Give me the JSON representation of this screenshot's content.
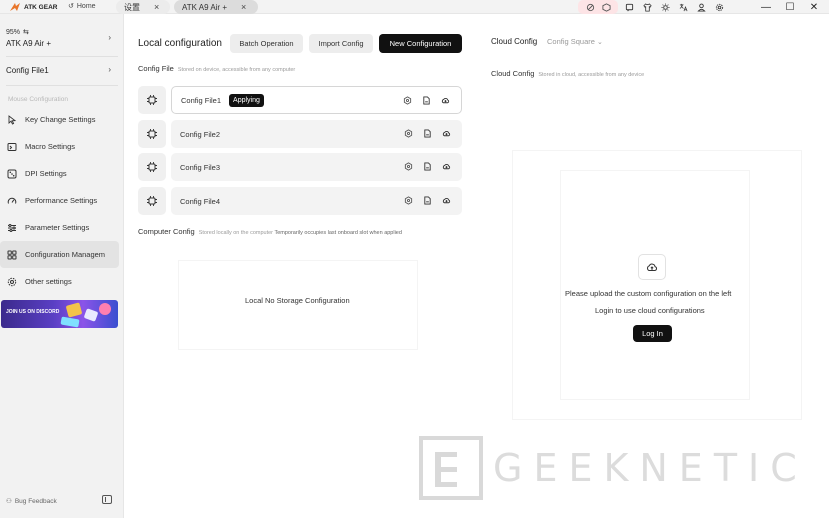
{
  "titlebar": {
    "app_name": "ATK GEAR",
    "home_label": "Home",
    "tabs": [
      {
        "label": "设置",
        "close": "×"
      },
      {
        "label": "ATK A9 Air +",
        "close": "×"
      }
    ],
    "icons": [
      "cancel-icon",
      "box-icon",
      "chat-icon",
      "shirt-icon",
      "sun-icon",
      "translate-icon",
      "user-icon",
      "gear-icon"
    ],
    "window_controls": [
      "minimize",
      "maximize",
      "close"
    ]
  },
  "sidebar": {
    "battery": "95%",
    "device_name": "ATK A9 Air +",
    "config_selector": "Config File1",
    "section_label": "Mouse Configuration",
    "items": [
      {
        "label": "Key Change Settings",
        "icon": "cursor-icon",
        "active": false
      },
      {
        "label": "Macro Settings",
        "icon": "macro-icon",
        "active": false
      },
      {
        "label": "DPI Settings",
        "icon": "dice-icon",
        "active": false
      },
      {
        "label": "Performance Settings",
        "icon": "gauge-icon",
        "active": false
      },
      {
        "label": "Parameter Settings",
        "icon": "sliders-icon",
        "active": false
      },
      {
        "label": "Configuration Managem",
        "icon": "grid-icon",
        "active": true
      },
      {
        "label": "Other settings",
        "icon": "gear-icon",
        "active": false
      }
    ],
    "banner_text": "JOIN US ON DISCORD",
    "feedback_label": "Bug Feedback"
  },
  "local": {
    "title": "Local configuration",
    "batch_label": "Batch Operation",
    "import_label": "Import Config",
    "new_label": "New Configuration",
    "config_file_title": "Config File",
    "config_file_desc": "Stored on device, accessible from any computer",
    "configs": [
      {
        "name": "Config File1",
        "badge": "Applying"
      },
      {
        "name": "Config File2",
        "badge": ""
      },
      {
        "name": "Config File3",
        "badge": ""
      },
      {
        "name": "Config File4",
        "badge": ""
      }
    ],
    "computer_title": "Computer Config",
    "computer_desc": "Stored locally on the computer",
    "computer_desc2": "Temporarily occupies last onboard slot when applied",
    "empty_text": "Local No Storage Configuration"
  },
  "cloud": {
    "title": "Cloud Config",
    "square_label": "Config Square",
    "section_title": "Cloud Config",
    "section_desc": "Stored in cloud, accessible from any device",
    "msg1": "Please upload the custom configuration on the left",
    "msg2": "Login to use cloud configurations",
    "login_label": "Log In"
  },
  "watermark": "GEEKNETIC"
}
